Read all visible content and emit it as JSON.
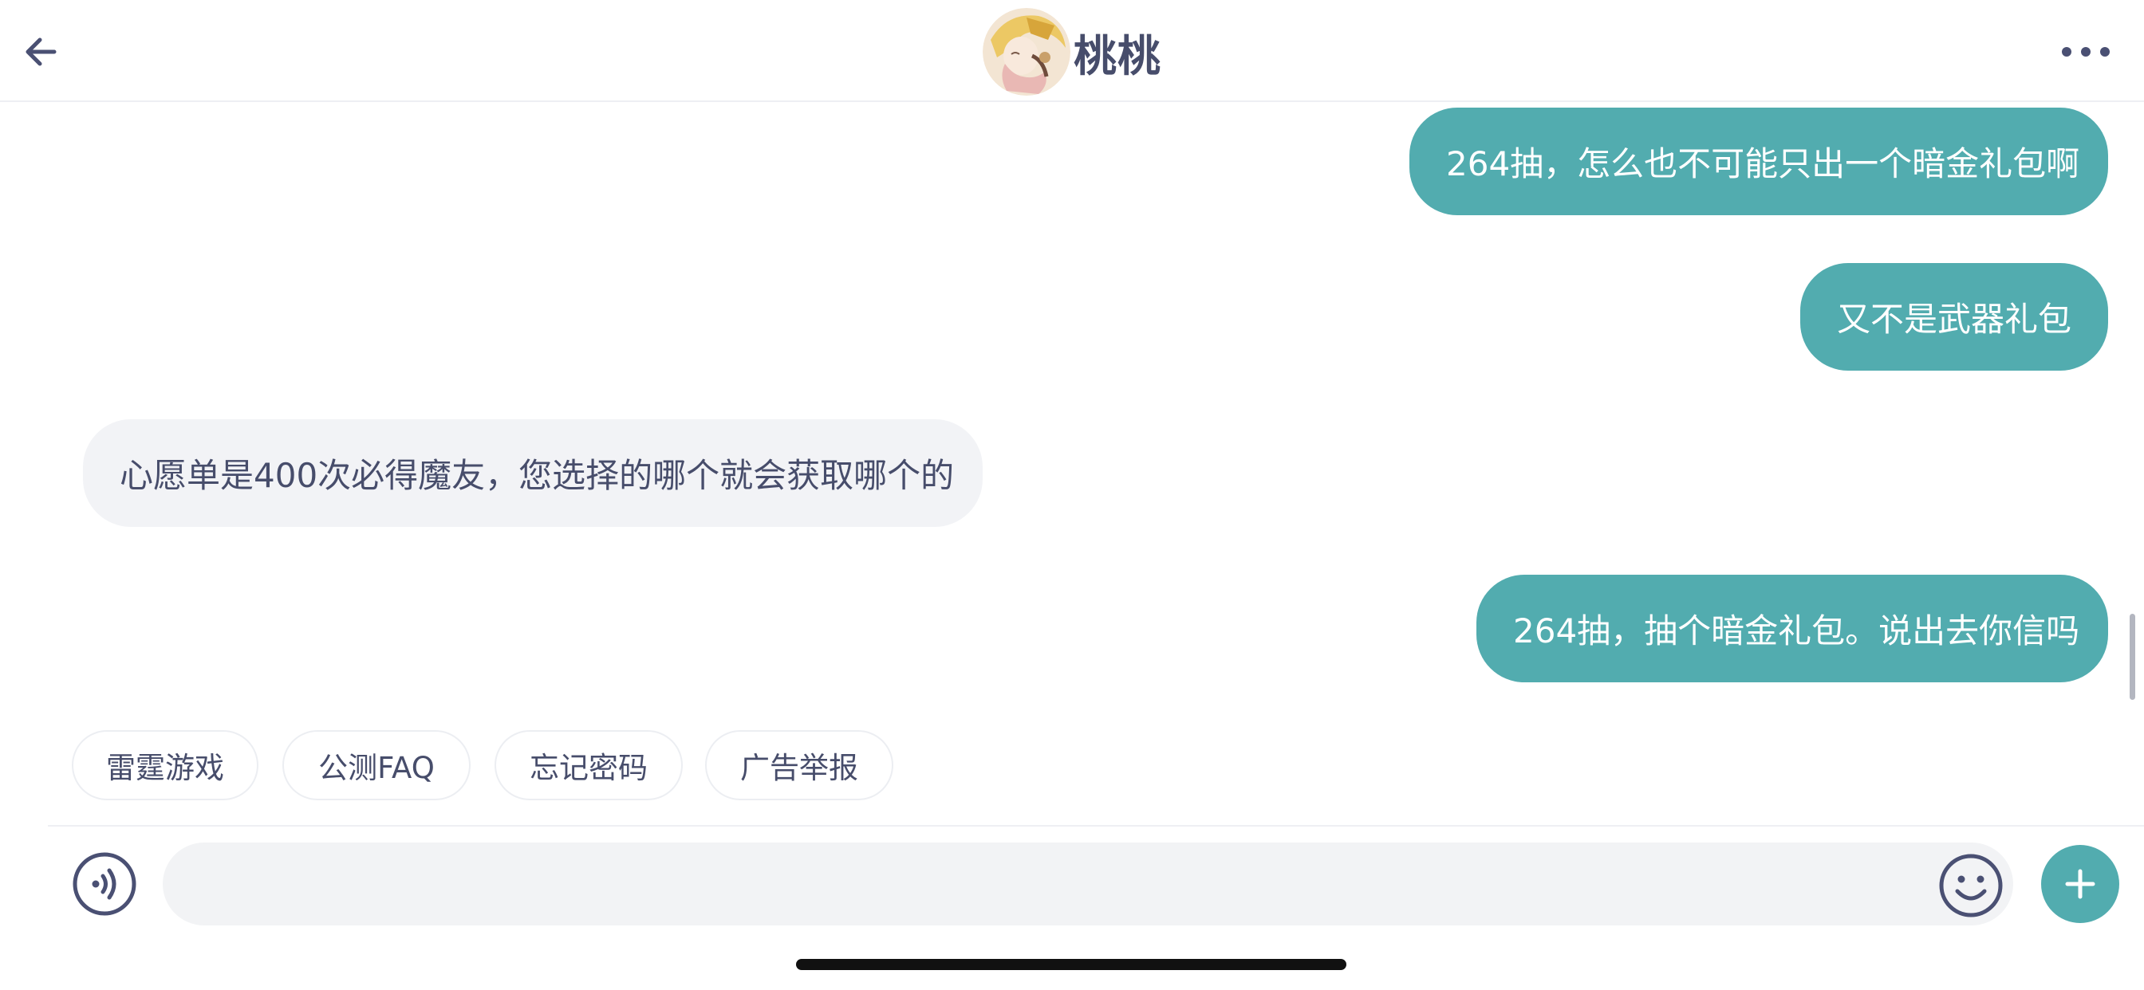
{
  "header": {
    "title": "桃桃",
    "back_icon": "arrow-left-icon",
    "more_icon": "more-horizontal-icon",
    "avatar": "avatar-image"
  },
  "messages": [
    {
      "side": "out",
      "text": "264抽，怎么也不可能只出一个暗金礼包啊"
    },
    {
      "side": "out",
      "text": "又不是武器礼包"
    },
    {
      "side": "in",
      "text": "心愿单是400次必得魔友，您选择的哪个就会获取哪个的"
    },
    {
      "side": "out",
      "text": "264抽，抽个暗金礼包。说出去你信吗"
    }
  ],
  "quick_replies": [
    {
      "label": "雷霆游戏"
    },
    {
      "label": "公测FAQ"
    },
    {
      "label": "忘记密码"
    },
    {
      "label": "广告举报"
    }
  ],
  "input": {
    "value": "",
    "placeholder": "",
    "voice_icon": "voice-icon",
    "emoji_icon": "emoji-icon",
    "plus_icon": "plus-icon"
  },
  "colors": {
    "accent": "#52acaf",
    "incoming_bubble": "#f2f3f6",
    "text": "#474d6b"
  }
}
